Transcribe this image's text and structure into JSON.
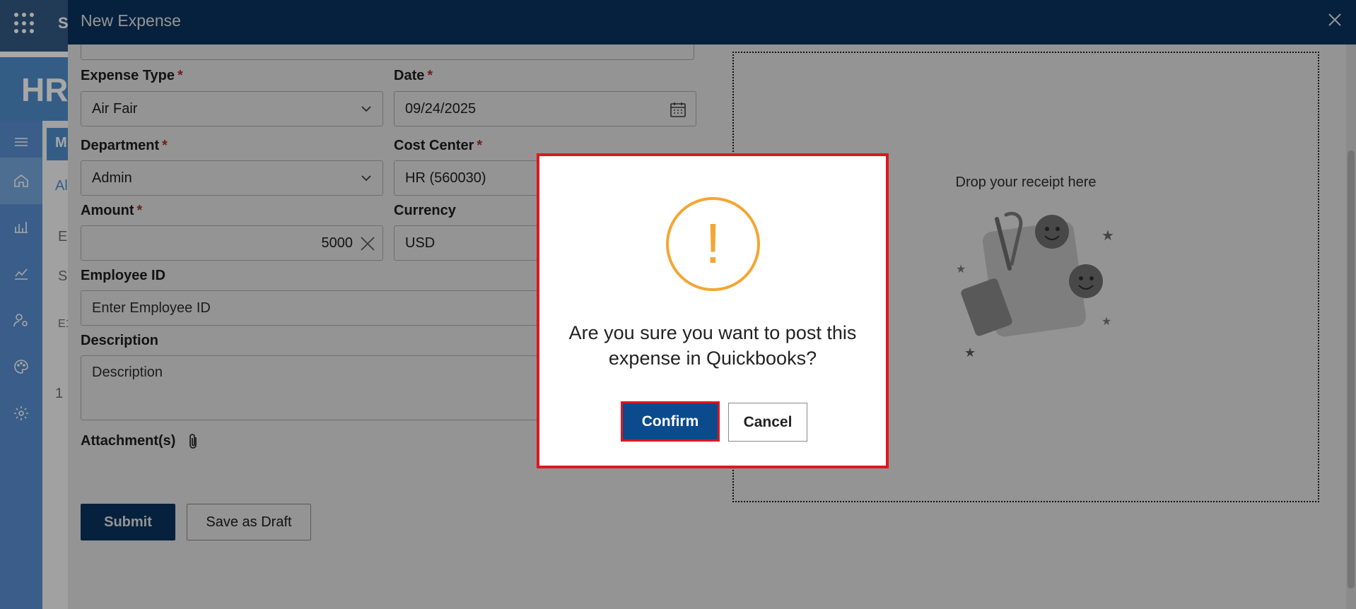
{
  "app": {
    "title_peek": "S",
    "banner_peek": "HR",
    "content_peek": {
      "tile": "M",
      "tab": "Al",
      "row1": "E",
      "row2": "S",
      "row3": "E1",
      "page": "1"
    },
    "rail_icons": [
      "hamburger-icon",
      "home-icon",
      "bar-chart-icon",
      "line-chart-icon",
      "user-settings-icon",
      "palette-icon",
      "gear-icon"
    ]
  },
  "panel": {
    "title": "New Expense",
    "fields": {
      "expense_type": {
        "label": "Expense Type",
        "required": "*",
        "value": "Air Fair"
      },
      "date": {
        "label": "Date",
        "required": "*",
        "value": "09/24/2025"
      },
      "department": {
        "label": "Department",
        "required": "*",
        "value": "Admin"
      },
      "cost_center": {
        "label": "Cost Center",
        "required": "*",
        "value": "HR (560030)"
      },
      "amount": {
        "label": "Amount",
        "required": "*",
        "value": "5000"
      },
      "currency": {
        "label": "Currency",
        "value": "USD"
      },
      "employee_id": {
        "label": "Employee ID",
        "placeholder": "Enter Employee ID"
      },
      "description": {
        "label": "Description",
        "placeholder": "Description"
      },
      "attachments": {
        "label": "Attachment(s)"
      }
    },
    "buttons": {
      "submit": "Submit",
      "save_draft": "Save as Draft"
    },
    "dropzone": {
      "text": "Drop your receipt here"
    }
  },
  "dialog": {
    "icon": "warning-icon",
    "mark": "!",
    "message": "Are you sure you want to post this expense in Quickbooks?",
    "confirm": "Confirm",
    "cancel": "Cancel"
  },
  "colors": {
    "header_navy": "#0b3a6b",
    "accent_blue": "#2f78c4",
    "warning_orange": "#f3a633",
    "highlight_red": "#e0161f",
    "required_red": "#c0392b"
  }
}
